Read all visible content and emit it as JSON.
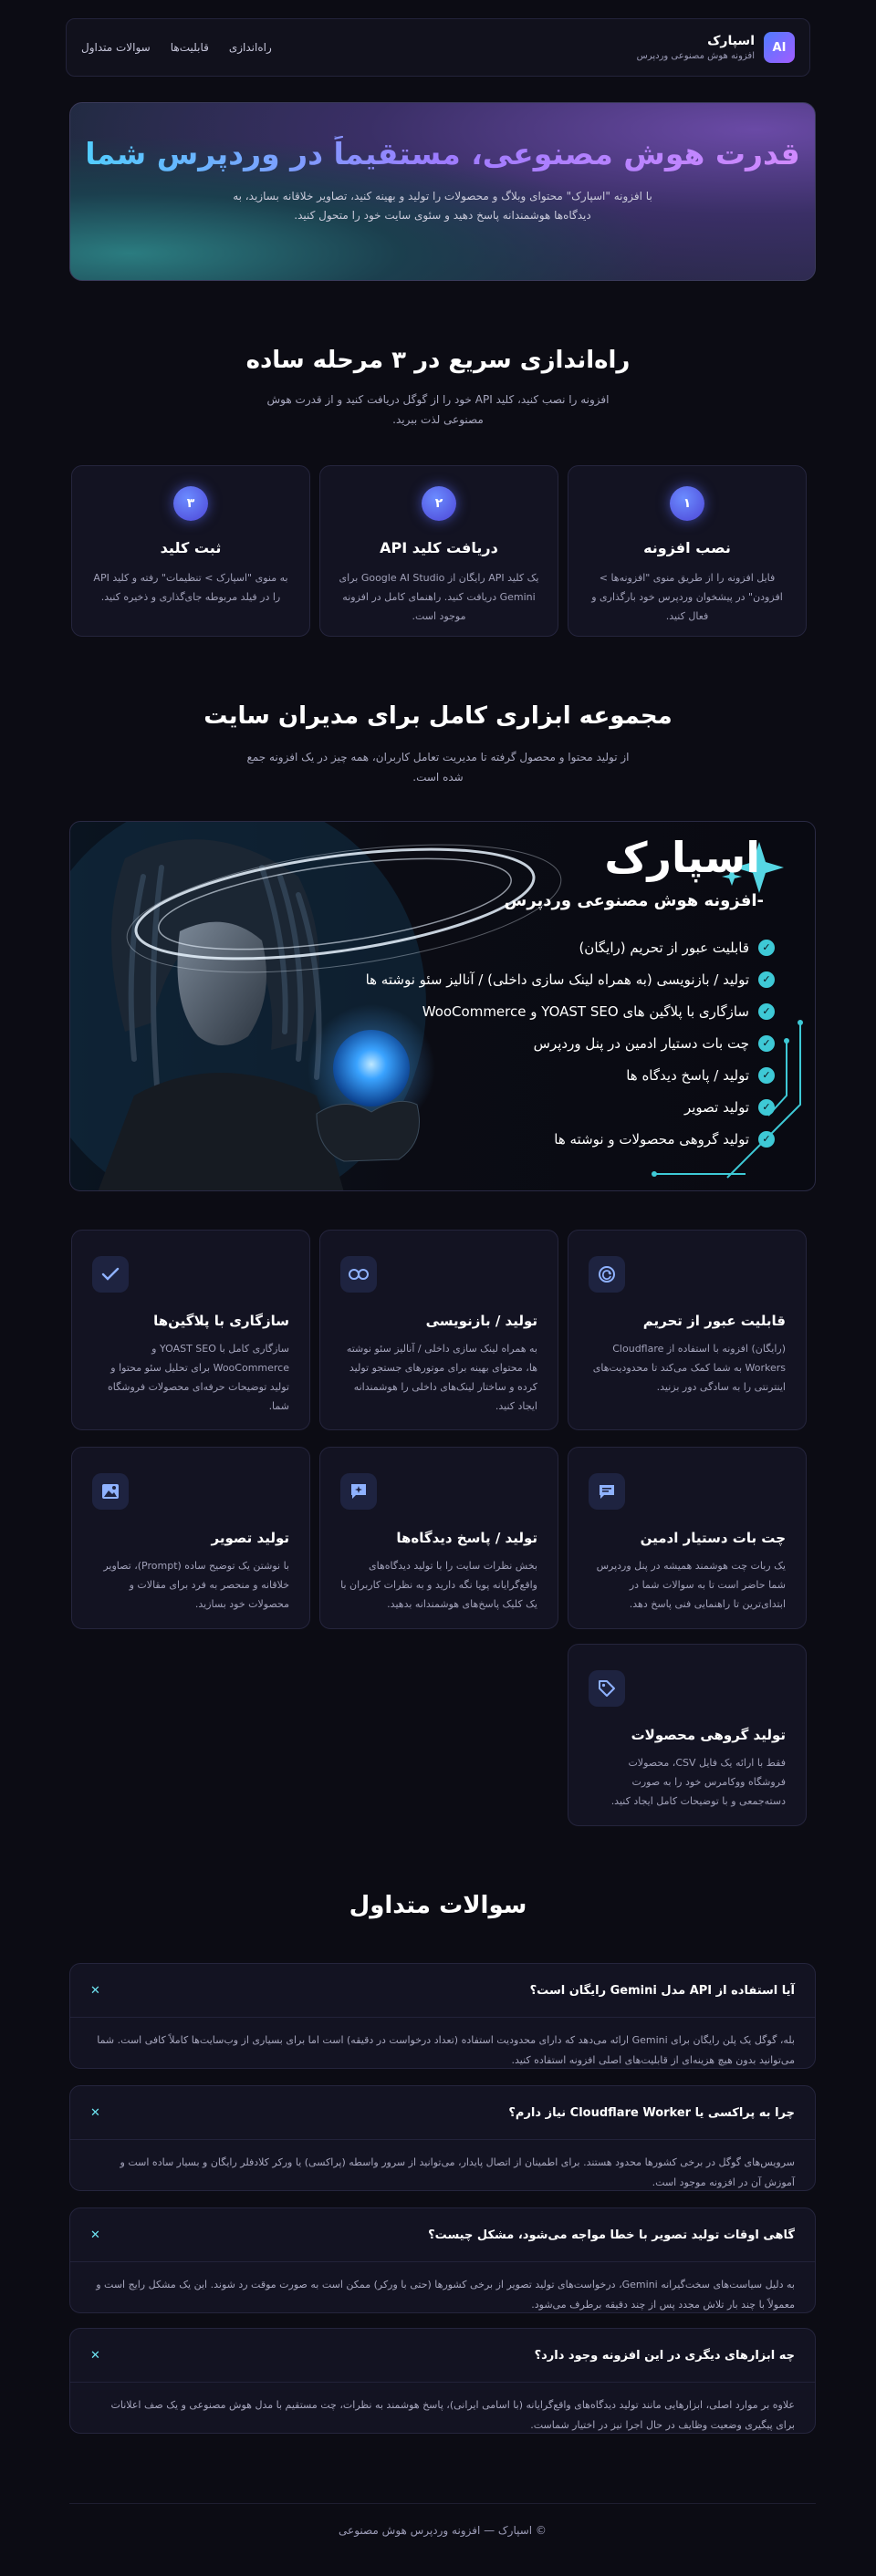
{
  "header": {
    "brand_name": "اسپارک",
    "brand_tag": "افزونه هوش مصنوعی وردپرس",
    "logo_text": "AI",
    "nav": [
      "راه‌اندازی",
      "قابلیت‌ها",
      "سوالات متداول"
    ]
  },
  "hero": {
    "title": "قدرت هوش مصنوعی، مستقیماً در وردپرس شما",
    "text": "با افزونه \"اسپارک\" محتوای وبلاگ و محصولات را تولید و بهینه کنید، تصاویر خلاقانه بسازید، به دیدگاه‌ها هوشمندانه پاسخ دهید و سئوی سایت خود را متحول کنید."
  },
  "setup": {
    "title": "راه‌اندازی سریع در ۳ مرحله ساده",
    "subtitle": "افزونه را نصب کنید، کلید API خود را از گوگل دریافت کنید و از قدرت هوش مصنوعی لذت ببرید.",
    "steps": [
      {
        "num": "۱",
        "title": "نصب افزونه",
        "text": "فایل افزونه را از طریق منوی \"افزونه‌ها > افزودن\" در پیشخوان وردپرس خود بارگذاری و فعال کنید."
      },
      {
        "num": "۲",
        "title": "دریافت کلید API",
        "text": "یک کلید API رایگان از Google AI Studio برای Gemini دریافت کنید. راهنمای کامل در افزونه موجود است."
      },
      {
        "num": "۳",
        "title": "ثبت کلید",
        "text": "به منوی \"اسپارک > تنظیمات\" رفته و کلید API را در فیلد مربوطه جای‌گذاری و ذخیره کنید."
      }
    ]
  },
  "tools": {
    "title": "مجموعه ابزاری کامل برای مدیران سایت",
    "subtitle": "از تولید محتوا و محصول گرفته تا مدیریت تعامل کاربران، همه چیز در یک افزونه جمع شده است."
  },
  "banner": {
    "title": "اسپارک",
    "subtitle": "-افزونه هوش مصنوعی وردپرس",
    "items": [
      "قابلیت عبور از تحریم (رایگان)",
      "تولید / بازنویسی (به همراه لینک سازی داخلی) / آنالیز سئو نوشته ها",
      "سازگاری با پلاگین های YOAST SEO و WooCommerce",
      "چت بات دستیار ادمین در پنل وردپرس",
      "تولید / پاسخ دیدگاه ها",
      "تولید تصویر",
      "تولید گروهی محصولات و نوشته ها"
    ]
  },
  "features": [
    {
      "icon": "bypass-icon",
      "title": "قابلیت عبور از تحریم",
      "text": "(رایگان) افزونه با استفاده از Cloudflare Workers به شما کمک می‌کند تا محدودیت‌های اینترنتی را به سادگی دور بزنید."
    },
    {
      "icon": "link-icon",
      "title": "تولید / بازنویسی",
      "text": "به همراه لینک سازی داخلی / آنالیز سئو نوشته ها، محتوای بهینه برای موتورهای جستجو تولید کرده و ساختار لینک‌های داخلی را هوشمندانه ایجاد کنید."
    },
    {
      "icon": "check-icon",
      "title": "سازگاری با پلاگین‌ها",
      "text": "سازگاری کامل با YOAST SEO و WooCommerce برای تحلیل سئو محتوا و تولید توضیحات حرفه‌ای محصولات فروشگاه شما."
    },
    {
      "icon": "chat-icon",
      "title": "چت بات دستیار ادمین",
      "text": "یک ربات چت هوشمند همیشه در پنل وردپرس شما حاضر است تا به سوالات شما در ابتدای‌ترین تا راهنمایی فنی پاسخ دهد."
    },
    {
      "icon": "comment-icon",
      "title": "تولید / پاسخ دیدگاه‌ها",
      "text": "بخش نظرات سایت را با تولید دیدگاه‌های واقع‌گرایانه پویا نگه دارید و به نظرات کاربران با یک کلیک پاسخ‌های هوشمندانه بدهید."
    },
    {
      "icon": "image-icon",
      "title": "تولید تصویر",
      "text": "با نوشتن یک توضیح ساده (Prompt)، تصاویر خلاقانه و منحصر به فرد برای مقالات و محصولات خود بسازید."
    },
    {
      "icon": "tag-icon",
      "title": "تولید گروهی محصولات",
      "text": "فقط با ارائه یک فایل CSV، محصولات فروشگاه ووکامرس خود را به صورت دسته‌جمعی و با توضیحات کامل ایجاد کنید."
    }
  ],
  "faq": {
    "title": "سوالات متداول",
    "items": [
      {
        "q": "آیا استفاده از API مدل Gemini رایگان است؟",
        "a": "بله، گوگل یک پلن رایگان برای Gemini ارائه می‌دهد که دارای محدودیت استفاده (تعداد درخواست در دقیقه) است اما برای بسیاری از وب‌سایت‌ها کاملاً کافی است. شما می‌توانید بدون هیچ هزینه‌ای از قابلیت‌های اصلی افزونه استفاده کنید."
      },
      {
        "q": "چرا به پراکسی یا Cloudflare Worker نیاز دارم؟",
        "a": "سرویس‌های گوگل در برخی کشورها محدود هستند. برای اطمینان از اتصال پایدار، می‌توانید از سرور واسطه (پراکسی) یا ورکر کلادفلر رایگان و بسیار ساده است و آموزش آن در افزونه موجود است."
      },
      {
        "q": "گاهی اوقات تولید تصویر با خطا مواجه می‌شود، مشکل چیست؟",
        "a": "به دلیل سیاست‌های سخت‌گیرانه Gemini، درخواست‌های تولید تصویر از برخی کشورها (حتی با ورکر) ممکن است به صورت موقت رد شوند. این یک مشکل رایج است و معمولاً با چند بار تلاش مجدد پس از چند دقیقه برطرف می‌شود."
      },
      {
        "q": "چه ابزارهای دیگری در این افزونه وجود دارد؟",
        "a": "علاوه بر موارد اصلی، ابزارهایی مانند تولید دیدگاه‌های واقع‌گرایانه (با اسامی ایرانی)، پاسخ هوشمند به نظرات، چت مستقیم با مدل هوش مصنوعی و یک صف اعلانات برای پیگیری وضعیت وظایف در حال اجرا نیز در اختیار شماست."
      }
    ]
  },
  "footer": {
    "text": "© اسپارک — افزونه وردپرس هوش مصنوعی"
  },
  "colors": {
    "accent": "#6d5dfc",
    "check": "#3ec9d6",
    "bg": "#0c0c14"
  }
}
